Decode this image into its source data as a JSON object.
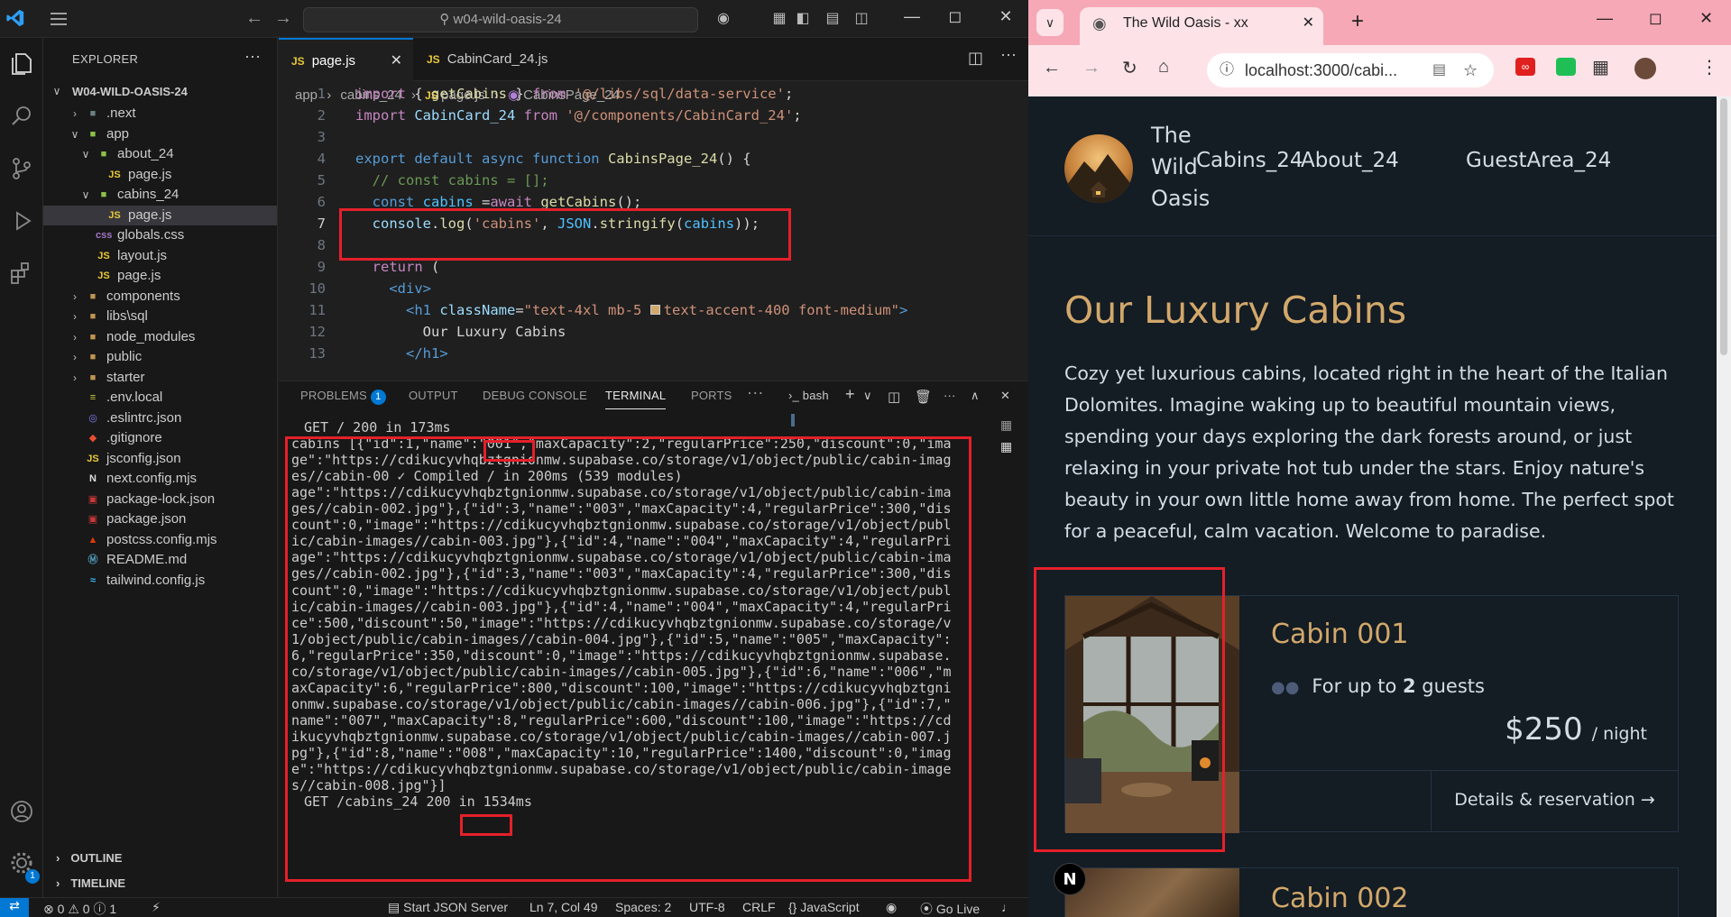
{
  "vscode": {
    "title_search": "w04-wild-oasis-24",
    "explorer": {
      "header": "EXPLORER",
      "project": "W04-WILD-OASIS-24",
      "items": [
        {
          "label": ".next",
          "kind": "folder-dot"
        },
        {
          "label": "app",
          "kind": "folder-open"
        },
        {
          "label": "about_24",
          "kind": "folder-open"
        },
        {
          "label": "page.js",
          "kind": "js"
        },
        {
          "label": "cabins_24",
          "kind": "folder-open"
        },
        {
          "label": "page.js",
          "kind": "js"
        },
        {
          "label": "globals.css",
          "kind": "css"
        },
        {
          "label": "layout.js",
          "kind": "js"
        },
        {
          "label": "page.js",
          "kind": "js"
        },
        {
          "label": "components",
          "kind": "folder"
        },
        {
          "label": "libs\\sql",
          "kind": "folder"
        },
        {
          "label": "node_modules",
          "kind": "folder"
        },
        {
          "label": "public",
          "kind": "folder"
        },
        {
          "label": "starter",
          "kind": "folder"
        },
        {
          "label": ".env.local",
          "kind": "env"
        },
        {
          "label": ".eslintrc.json",
          "kind": "eslint"
        },
        {
          "label": ".gitignore",
          "kind": "git"
        },
        {
          "label": "jsconfig.json",
          "kind": "jsconfig"
        },
        {
          "label": "next.config.mjs",
          "kind": "next"
        },
        {
          "label": "package-lock.json",
          "kind": "npm"
        },
        {
          "label": "package.json",
          "kind": "npm"
        },
        {
          "label": "postcss.config.mjs",
          "kind": "postcss"
        },
        {
          "label": "README.md",
          "kind": "md"
        },
        {
          "label": "tailwind.config.js",
          "kind": "tailwind"
        }
      ],
      "outline": "OUTLINE",
      "timeline": "TIMELINE"
    },
    "tabs": [
      {
        "label": "page.js",
        "active": true
      },
      {
        "label": "CabinCard_24.js",
        "active": false
      }
    ],
    "breadcrumb": {
      "a": "app",
      "b": "cabins_24",
      "c": "page.js",
      "d": "CabinsPage_24"
    },
    "code_lines": [
      "1",
      "2",
      "3",
      "4",
      "5",
      "6",
      "7",
      "8",
      "9",
      "10",
      "11",
      "12",
      "13"
    ],
    "code": {
      "l1_import": "import",
      "l1_a": " { ",
      "l1_fn": "getCabins",
      "l1_b": " } ",
      "l1_from": "from",
      "l1_str": " '@/libs/sql/data-service'",
      "l1_end": ";",
      "l2_import": "import",
      "l2_var": " CabinCard_24 ",
      "l2_from": "from",
      "l2_str": " '@/components/CabinCard_24'",
      "l2_end": ";",
      "l4_export": "export default async function",
      "l4_fn": " CabinsPage_24",
      "l4_end": "() {",
      "l5": "  // const cabins = [];",
      "l6_const": "  const",
      "l6_var": " cabins ",
      "l6_eq": "=",
      "l6_await": "await",
      "l6_fn": " getCabins",
      "l6_end": "();",
      "l7_console": "  console",
      "l7_dot": ".",
      "l7_log": "log",
      "l7_a": "(",
      "l7_str": "'cabins'",
      "l7_b": ", ",
      "l7_json": "JSON",
      "l7_dot2": ".",
      "l7_fn": "stringify",
      "l7_c": "(",
      "l7_var": "cabins",
      "l7_end": "));",
      "l9_return": "  return",
      "l9_end": " (",
      "l10": "    <div>",
      "l11_tag": "      <h1",
      "l11_attr": " className",
      "l11_eq": "=",
      "l11_str": "\"text-4xl mb-5 ",
      "l11_str2": "text-accent-400 font-medium\"",
      "l11_end": ">",
      "l12": "        Our Luxury Cabins",
      "l13": "      </h1>"
    },
    "panel_tabs": {
      "problems": "PROBLEMS",
      "problems_count": "1",
      "output": "OUTPUT",
      "debug": "DEBUG CONSOLE",
      "terminal": "TERMINAL",
      "ports": "PORTS",
      "shell": "bash"
    },
    "terminal_lines": [
      "GET / 200 in 173ms",
      "cabins [{\"id\":1,\"name\":\"001\",\"maxCapacity\":2,\"regularPrice\":250,\"discount\":0,\"ima",
      "ge\":\"https://cdikucyvhqbztgnionmw.supabase.co/storage/v1/object/public/cabin-imag",
      "es//cabin-00 ✓ Compiled / in 200ms (539 modules)",
      "age\":\"https://cdikucyvhqbztgnionmw.supabase.co/storage/v1/object/public/cabin-ima",
      "ges//cabin-002.jpg\"},{\"id\":3,\"name\":\"003\",\"maxCapacity\":4,\"regularPrice\":300,\"dis",
      "count\":0,\"image\":\"https://cdikucyvhqbztgnionmw.supabase.co/storage/v1/object/publ",
      "ic/cabin-images//cabin-003.jpg\"},{\"id\":4,\"name\":\"004\",\"maxCapacity\":4,\"regularPri",
      "age\":\"https://cdikucyvhqbztgnionmw.supabase.co/storage/v1/object/public/cabin-ima",
      "ges//cabin-002.jpg\"},{\"id\":3,\"name\":\"003\",\"maxCapacity\":4,\"regularPrice\":300,\"dis",
      "count\":0,\"image\":\"https://cdikucyvhqbztgnionmw.supabase.co/storage/v1/object/publ",
      "ic/cabin-images//cabin-003.jpg\"},{\"id\":4,\"name\":\"004\",\"maxCapacity\":4,\"regularPri",
      "ce\":500,\"discount\":50,\"image\":\"https://cdikucyvhqbztgnionmw.supabase.co/storage/v",
      "1/object/public/cabin-images//cabin-004.jpg\"},{\"id\":5,\"name\":\"005\",\"maxCapacity\":",
      "6,\"regularPrice\":350,\"discount\":0,\"image\":\"https://cdikucyvhqbztgnionmw.supabase.",
      "co/storage/v1/object/public/cabin-images//cabin-005.jpg\"},{\"id\":6,\"name\":\"006\",\"m",
      "axCapacity\":6,\"regularPrice\":800,\"discount\":100,\"image\":\"https://cdikucyvhqbztgni",
      "onmw.supabase.co/storage/v1/object/public/cabin-images//cabin-006.jpg\"},{\"id\":7,\"",
      "name\":\"007\",\"maxCapacity\":8,\"regularPrice\":600,\"discount\":100,\"image\":\"https://cd",
      "ikucyvhqbztgnionmw.supabase.co/storage/v1/object/public/cabin-images//cabin-007.j",
      "pg\"},{\"id\":8,\"name\":\"008\",\"maxCapacity\":10,\"regularPrice\":1400,\"discount\":0,\"imag",
      "e\":\"https://cdikucyvhqbztgnionmw.supabase.co/storage/v1/object/public/cabin-image",
      "s//cabin-008.jpg\"}]",
      "GET /cabins_24 200 in 1534ms"
    ],
    "status": {
      "errors": "0",
      "warnings": "0",
      "info": "1",
      "json_server": "Start JSON Server",
      "position": "Ln 7, Col 49",
      "spaces": "Spaces: 2",
      "encoding": "UTF-8",
      "eol": "CRLF",
      "language": "{} JavaScript",
      "golive": "Go Live",
      "account_badge": "1"
    }
  },
  "chrome": {
    "tab_title": "The Wild Oasis - xx",
    "url": "localhost:3000/cabi...",
    "site": {
      "brand": "The Wild Oasis",
      "nav": [
        "Cabins_24",
        "About_24",
        "GuestArea_24"
      ],
      "heading": "Our Luxury Cabins",
      "intro": "Cozy yet luxurious cabins, located right in the heart of the Italian Dolomites. Imagine waking up to beautiful mountain views, spending your days exploring the dark forests around, or just relaxing in your private hot tub under the stars. Enjoy nature's beauty in your own little home away from home. The perfect spot for a peaceful, calm vacation. Welcome to paradise.",
      "cards": [
        {
          "title": "Cabin 001",
          "guests_prefix": "For up to ",
          "guests": "2",
          "guests_suffix": " guests",
          "price": "$250",
          "per": "/ night",
          "cta": "Details & reservation →"
        },
        {
          "title": "Cabin 002"
        }
      ],
      "next_badge": "N"
    }
  },
  "colors": {
    "annotation_red": "#e5202a",
    "accent_gold": "#d2a86a",
    "vscode_blue": "#0078d4",
    "site_bg": "#141c24",
    "chrome_pink": "#f6a8b6"
  }
}
